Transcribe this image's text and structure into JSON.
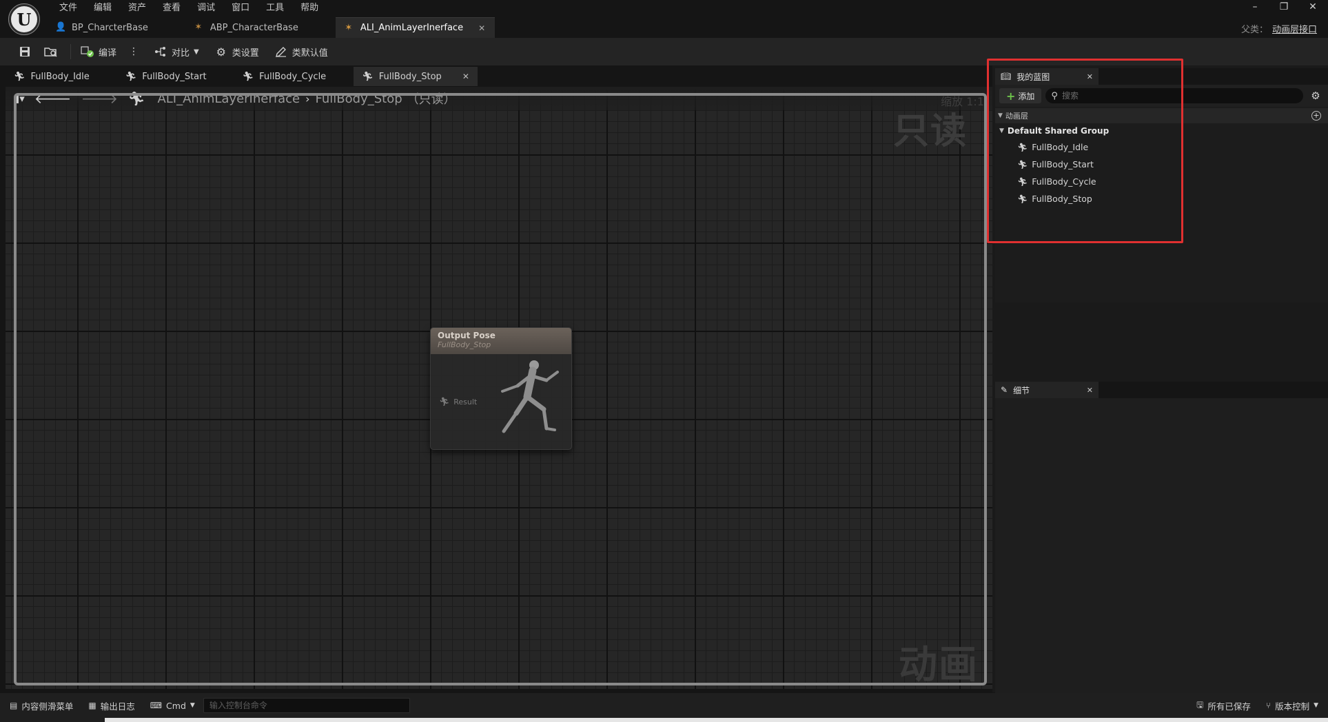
{
  "menu": [
    "文件",
    "编辑",
    "资产",
    "查看",
    "调试",
    "窗口",
    "工具",
    "帮助"
  ],
  "doc_tabs": [
    {
      "label": "BP_CharcterBase",
      "icon": "person-icon"
    },
    {
      "label": "ABP_CharacterBase",
      "icon": "anim-blueprint-icon"
    },
    {
      "label": "ALI_AnimLayerInerface",
      "icon": "anim-layer-interface-icon",
      "active": true
    }
  ],
  "parent": {
    "label": "父类：",
    "value": "动画层接口"
  },
  "window_controls": {
    "minimize": "–",
    "restore": "❐",
    "close": "✕"
  },
  "toolbar": {
    "compile": "编译",
    "diff": "对比",
    "class_settings": "类设置",
    "class_defaults": "类默认值"
  },
  "graph_tabs": [
    "FullBody_Idle",
    "FullBody_Start",
    "FullBody_Cycle",
    "FullBody_Stop"
  ],
  "graph": {
    "breadcrumb_root": "ALI_AnimLayerInerface",
    "breadcrumb_leaf": "FullBody_Stop",
    "readonly_suffix": "（只读）",
    "zoom": "缩放 1:1",
    "watermark_readonly": "只读",
    "watermark_type": "动画"
  },
  "node": {
    "title": "Output Pose",
    "subtitle": "FullBody_Stop",
    "pin": "Result"
  },
  "my_blueprint": {
    "tab": "我的蓝图",
    "add": "添加",
    "search_placeholder": "搜索",
    "category": "动画层",
    "group": "Default Shared Group",
    "items": [
      "FullBody_Idle",
      "FullBody_Start",
      "FullBody_Cycle",
      "FullBody_Stop"
    ]
  },
  "details": {
    "tab": "细节"
  },
  "statusbar": {
    "content_drawer": "内容侧滑菜单",
    "output_log": "输出日志",
    "cmd": "Cmd",
    "cmd_placeholder": "输入控制台命令",
    "all_saved": "所有已保存",
    "source_control": "版本控制"
  },
  "colors": {
    "accent_green": "#6dc24b",
    "highlight_red": "#e03030"
  }
}
